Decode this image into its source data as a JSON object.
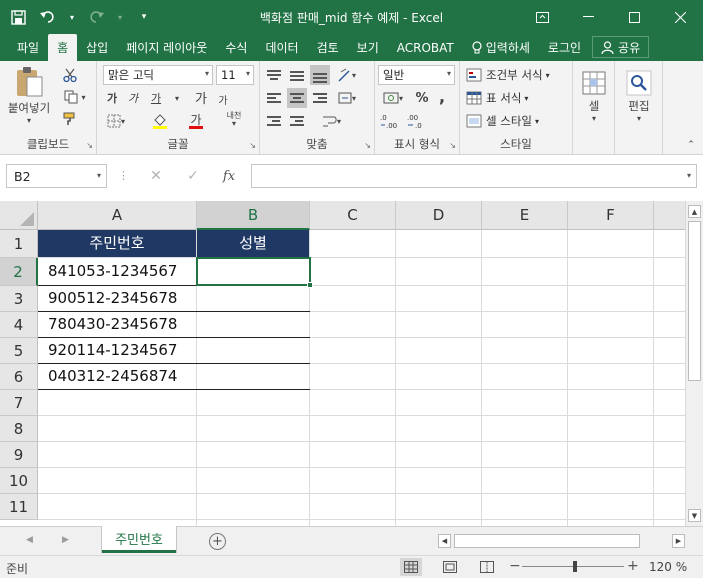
{
  "window": {
    "title": "백화점 판매_mid 함수 예제 - Excel",
    "qat": {
      "save_icon": "save-icon",
      "undo_icon": "undo-icon",
      "redo_icon": "redo-icon",
      "customize_icon": "customize-qat-icon"
    }
  },
  "tabs": [
    {
      "label": "파일",
      "active": false
    },
    {
      "label": "홈",
      "active": true
    },
    {
      "label": "삽입",
      "active": false
    },
    {
      "label": "페이지 레이아웃",
      "active": false
    },
    {
      "label": "수식",
      "active": false
    },
    {
      "label": "데이터",
      "active": false
    },
    {
      "label": "검토",
      "active": false
    },
    {
      "label": "보기",
      "active": false
    },
    {
      "label": "ACROBAT",
      "active": false
    }
  ],
  "tell_me": "입력하세",
  "account": "로그인",
  "share": "공유",
  "ribbon": {
    "clipboard": {
      "label": "클립보드",
      "paste": "붙여넣기"
    },
    "font": {
      "label": "글꼴",
      "font_name": "맑은 고딕",
      "font_size": "11",
      "bold": "가",
      "italic": "가",
      "underline": "가",
      "grow": "가",
      "shrink": "가",
      "color_letter": "가",
      "phonetic": "내천"
    },
    "alignment": {
      "label": "맞춤"
    },
    "number": {
      "label": "표시 형식",
      "format": "일반",
      "percent": "%",
      "comma": ","
    },
    "styles": {
      "label": "스타일",
      "conditional": "조건부 서식",
      "table": "표 서식",
      "cell_styles": "셀 스타일"
    },
    "cells": {
      "label": "셀"
    },
    "editing": {
      "label": "편집"
    }
  },
  "formula_bar": {
    "name_box": "B2",
    "formula": "",
    "fx": "fx"
  },
  "grid": {
    "columns": [
      "A",
      "B",
      "C",
      "D",
      "E",
      "F"
    ],
    "rows": [
      "1",
      "2",
      "3",
      "4",
      "5",
      "6",
      "7",
      "8",
      "9",
      "10",
      "11"
    ],
    "header_row": [
      "주민번호",
      "성별"
    ],
    "data": [
      [
        "841053-1234567",
        ""
      ],
      [
        "900512-2345678",
        ""
      ],
      [
        "780430-2345678",
        ""
      ],
      [
        "920114-1234567",
        ""
      ],
      [
        "040312-2456874",
        ""
      ]
    ],
    "selected_cell": "B2",
    "header_fill": "#1f3864"
  },
  "sheets": [
    {
      "name": "주민번호",
      "active": true
    }
  ],
  "status": {
    "ready": "준비",
    "zoom": "120 %"
  },
  "colors": {
    "excel_green": "#217346",
    "header_navy": "#1f3864"
  }
}
